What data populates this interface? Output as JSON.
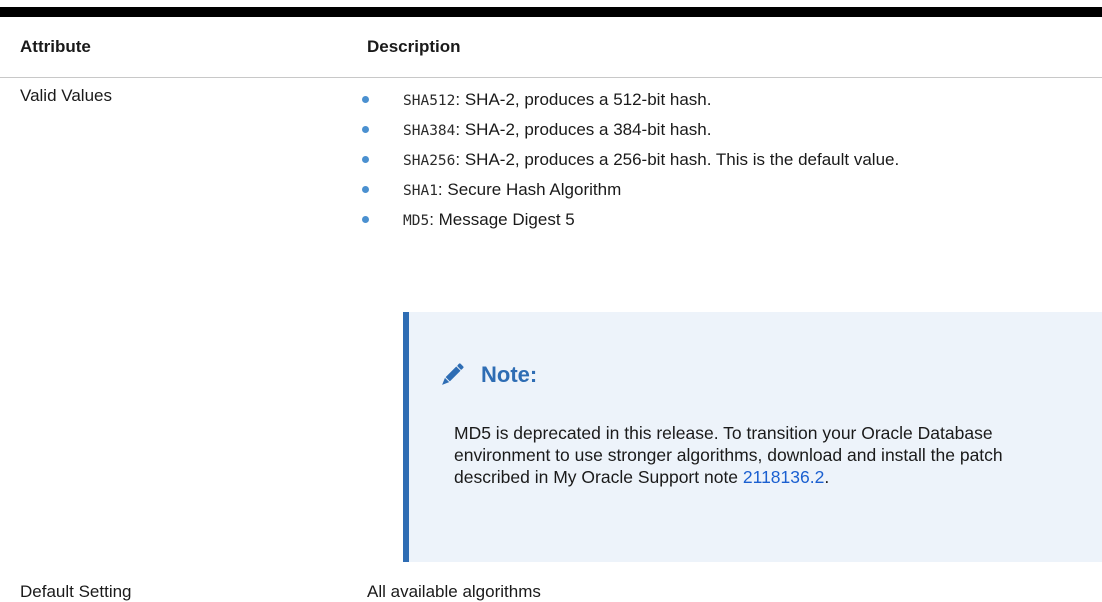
{
  "table": {
    "headers": {
      "attribute": "Attribute",
      "description": "Description"
    },
    "rows": {
      "valid_values": {
        "label": "Valid Values",
        "items": [
          {
            "code": "SHA512",
            "text": ": SHA-2, produces a 512-bit hash."
          },
          {
            "code": "SHA384",
            "text": ": SHA-2, produces a 384-bit hash."
          },
          {
            "code": "SHA256",
            "text": ": SHA-2, produces a 256-bit hash. This is the default value."
          },
          {
            "code": "SHA1",
            "text": ": Secure Hash Algorithm"
          },
          {
            "code": "MD5",
            "text": ": Message Digest 5"
          }
        ],
        "note": {
          "icon": "pencil-icon",
          "title": "Note:",
          "body_text": "MD5 is deprecated in this release. To transition your Oracle Database environment to use stronger algorithms, download and install the patch described in My Oracle Support note ",
          "link_text": "2118136.2",
          "body_end": "."
        }
      },
      "default_setting": {
        "label": "Default Setting",
        "value": "All available algorithms"
      }
    }
  },
  "colors": {
    "bullet": "#4a90d0",
    "note_accent": "#2e6db4",
    "note_background": "#edf3fa",
    "link": "#1a5fd0"
  }
}
